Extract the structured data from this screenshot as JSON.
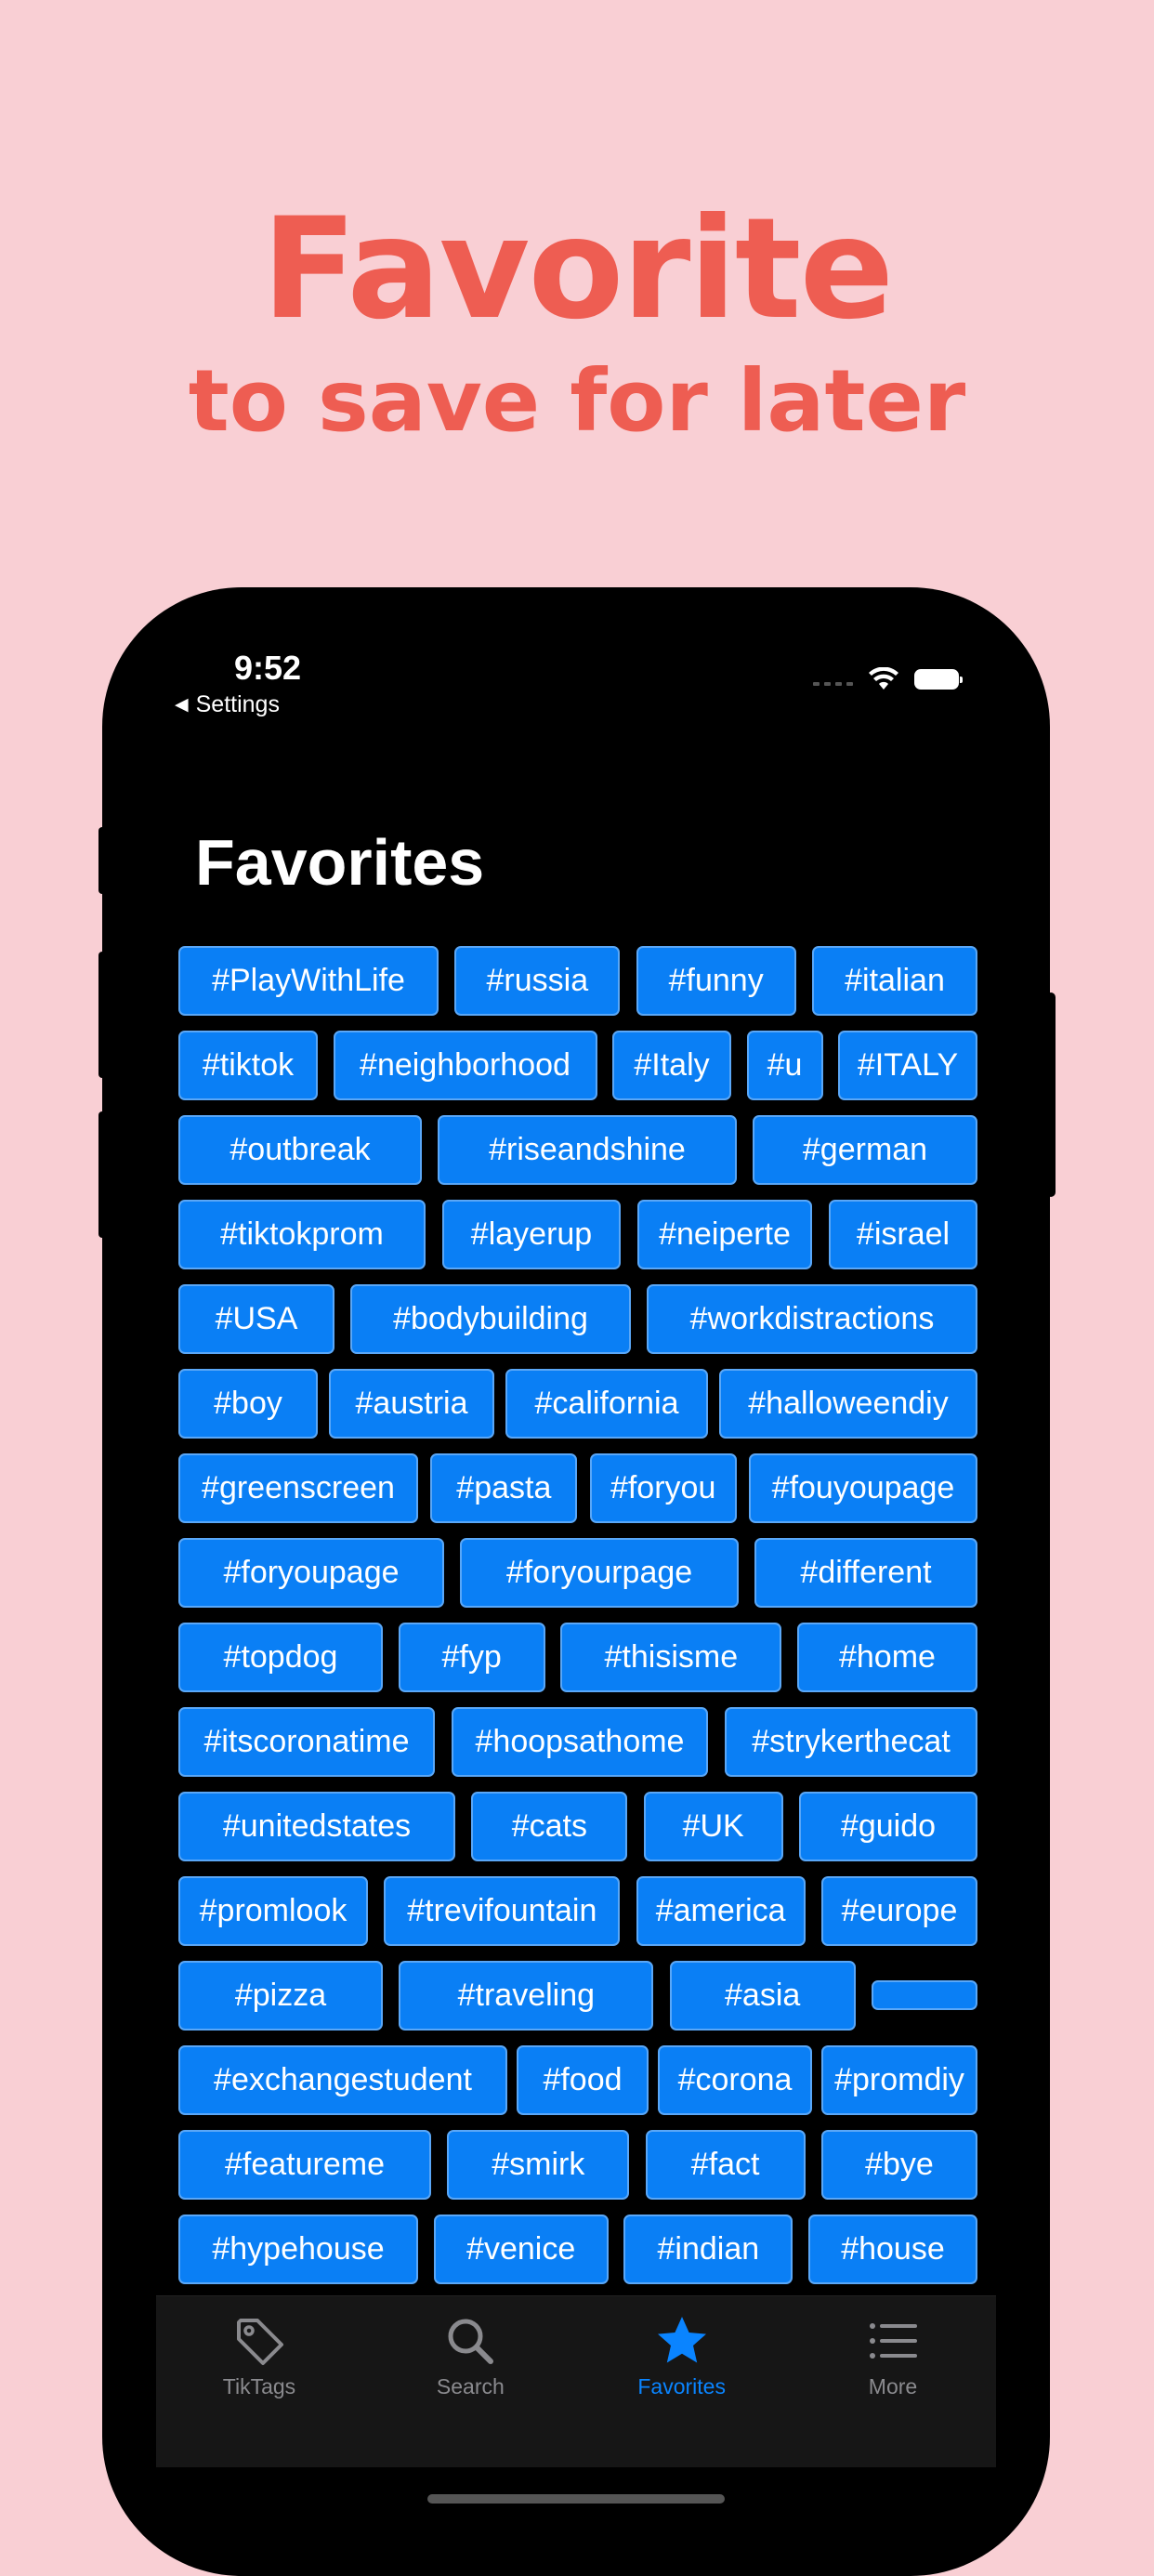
{
  "promo": {
    "title": "Favorite",
    "subtitle": "to save for later"
  },
  "status_bar": {
    "time": "9:52",
    "back_label": "Settings"
  },
  "page": {
    "title": "Favorites"
  },
  "tag_rows": [
    [
      "#PlayWithLife",
      "#russia",
      "#funny",
      "#italian"
    ],
    [
      "#tiktok",
      "#neighborhood",
      "#Italy",
      "#u",
      "#ITALY"
    ],
    [
      "#outbreak",
      "#riseandshine",
      "#german"
    ],
    [
      "#tiktokprom",
      "#layerup",
      "#neiperte",
      "#israel"
    ],
    [
      "#USA",
      "#bodybuilding",
      "#workdistractions"
    ],
    [
      "#boy",
      "#austria",
      "#california",
      "#halloweendiy"
    ],
    [
      "#greenscreen",
      "#pasta",
      "#foryou",
      "#fouyoupage"
    ],
    [
      "#foryoupage",
      "#foryourpage",
      "#different"
    ],
    [
      "#topdog",
      "#fyp",
      "#thisisme",
      "#home"
    ],
    [
      "#itscoronatime",
      "#hoopsathome",
      "#strykerthecat"
    ],
    [
      "#unitedstates",
      "#cats",
      "#UK",
      "#guido"
    ],
    [
      "#promlook",
      "#trevifountain",
      "#america",
      "#europe"
    ],
    [
      "#pizza",
      "#traveling",
      "#asia",
      ""
    ],
    [
      "#exchangestudent",
      "#food",
      "#corona",
      "#promdiy"
    ],
    [
      "#featureme",
      "#smirk",
      "#fact",
      "#bye"
    ],
    [
      "#hypehouse",
      "#venice",
      "#indian",
      "#house"
    ]
  ],
  "tab_bar": [
    {
      "label": "TikTags",
      "icon": "tag-icon",
      "active": false
    },
    {
      "label": "Search",
      "icon": "search-icon",
      "active": false
    },
    {
      "label": "Favorites",
      "icon": "star-icon",
      "active": true
    },
    {
      "label": "More",
      "icon": "list-icon",
      "active": false
    }
  ],
  "colors": {
    "background": "#f9cfd4",
    "promo_text": "#ee5d52",
    "tag_fill": "#0a7ff5",
    "active_tab": "#0a84ff",
    "inactive_tab": "#8a8a8e"
  }
}
